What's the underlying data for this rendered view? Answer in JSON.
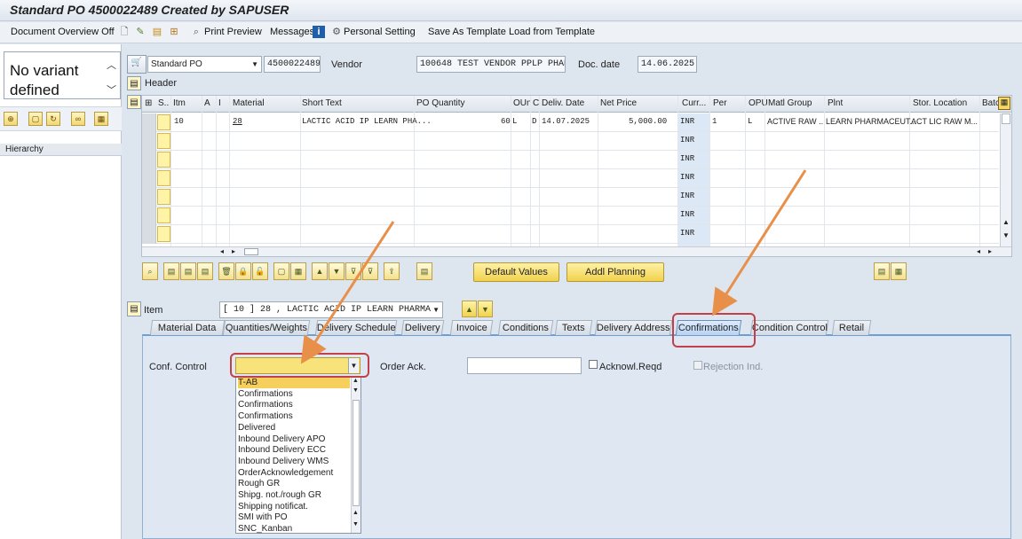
{
  "title": "Standard PO 4500022489 Created by SAPUSER",
  "toolbar": {
    "doc_overview": "Document Overview Off",
    "print_preview": "Print Preview",
    "messages": "Messages",
    "personal_setting": "Personal Setting",
    "save_template": "Save As Template",
    "load_template": "Load from Template"
  },
  "left": {
    "variant_line1": "No variant",
    "variant_line2": "defined",
    "hierarchy": "Hierarchy"
  },
  "header": {
    "doc_type": "Standard PO",
    "po_number": "4500022489",
    "vendor_label": "Vendor",
    "vendor_value": "100648 TEST VENDOR PPLP PHARMA",
    "doc_date_label": "Doc. date",
    "doc_date_value": "14.06.2025",
    "header_label": "Header"
  },
  "grid": {
    "columns": [
      "S..",
      "Itm",
      "A",
      "I",
      "Material",
      "Short Text",
      "PO Quantity",
      "OUn",
      "C",
      "Deliv. Date",
      "Net Price",
      "Curr...",
      "Per",
      "OPU",
      "Matl Group",
      "Plnt",
      "Stor. Location",
      "Batc"
    ],
    "row1": {
      "itm": "10",
      "material": "28",
      "short_text": "LACTIC ACID IP LEARN PHA...",
      "qty": "60",
      "oun": "L",
      "c": "D",
      "deliv": "14.07.2025",
      "price": "5,000.00",
      "curr": "INR",
      "per": "1",
      "opu": "L",
      "matl_group": "ACTIVE RAW ..",
      "plant": "LEARN PHARMACEUT...",
      "stor": "ACT LIC RAW M..."
    },
    "curr_default": "INR"
  },
  "buttons": {
    "default_values": "Default Values",
    "addl_planning": "Addl Planning"
  },
  "item": {
    "label": "Item",
    "value": "[ 10 ] 28 , LACTIC ACID IP LEARN PHARMA"
  },
  "tabs": [
    "Material Data",
    "Quantities/Weights",
    "Delivery Schedule",
    "Delivery",
    "Invoice",
    "Conditions",
    "Texts",
    "Delivery Address",
    "Confirmations",
    "Condition Control",
    "Retail"
  ],
  "confirmations": {
    "conf_control_label": "Conf. Control",
    "order_ack_label": "Order Ack.",
    "acknowl_label": "Acknowl.Reqd",
    "rejection_label": "Rejection Ind."
  },
  "dropdown": [
    "T-AB",
    "Confirmations",
    "Confirmations",
    "Confirmations",
    "Delivered",
    "Inbound Delivery APO",
    "Inbound Delivery ECC",
    "Inbound Delivery WMS",
    "OrderAcknowledgement",
    "Rough GR",
    "Shipg. not./rough GR",
    "Shipping notificat.",
    "SMI with PO",
    "SNC_Kanban"
  ],
  "colors": {
    "highlight": "#c0414a",
    "arrow": "#e8904a",
    "dropdown_selected": "#f6cf5c"
  }
}
